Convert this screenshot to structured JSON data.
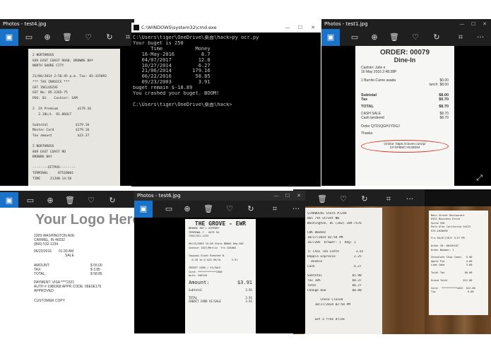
{
  "windows": {
    "test4": {
      "title": "Photos - test4.jpg",
      "receipt_lines": [
        "2 NORTHROSS",
        "849 EAST COAST ROAD, BROWNS BAY",
        "NORTH SHORE CITY",
        "",
        "21/06/2014 2:56:45 p.m. Tax: 03-325092",
        "*** TAX INVOICE ***",
        "GST INCLUSIVE",
        "GST No: 85-2265-75",
        "POS: 01    Cashier: SAM",
        "",
        "2  2X Premium          $179.16",
        "   2.18L/L  91.86ULT",
        "",
        "Subtotal              $179.16",
        "Master Card           $179.16",
        "Tax amount             $23.37",
        "",
        "2 NORTHROSS",
        "849 EAST COAST RD",
        "BROWNS BAY",
        "",
        "--------EFTPOS--------",
        "TERMINAL     8751B001",
        "TIME     21JUN 14:56"
      ]
    },
    "cmd": {
      "title": "C:\\WINDOWS\\system32\\cmd.exe",
      "lines": [
        "C:\\Users\\tiger\\OneDrive\\桌面\\hack>py ocr.py",
        "Your buget is 250",
        "      Time           Money",
        "   16-May-2016         8.7",
        "   04/07/2017         12.0",
        "   10/27/2014         6.27",
        "   21/06/2014       179.16",
        "   06/22/2016        58.85",
        "   09/23/2003         3.91",
        "buget remain $-18.89",
        "You crashed your buget. BOOM!",
        "",
        "C:\\Users\\tiger\\OneDrive\\桌面\\hack>"
      ]
    },
    "test1": {
      "title": "Photos - test1.jpg",
      "order": "ORDER: 00079",
      "type": "Dine-In",
      "cashier": "Cashier: Julie e",
      "datetime": "16 May 2016 2:48:38P",
      "item": "1  Burrito-Carne asada",
      "item_sub": "lunch",
      "item_price1": "$0.00",
      "item_price2": "$8.00",
      "subtotal_label": "Subtotal",
      "subtotal": "$8.00",
      "tax_label": "Tax",
      "tax": "$0.70",
      "total_label": "TOTAL",
      "total": "$8.70",
      "cash_sale_label": "CASH SALE",
      "cash_sale": "$8.70",
      "cash_tendered_label": "Cash tendered",
      "cash_tendered": "$8.70",
      "order_id": "Order Q7D1QGH1YDGJ",
      "thanks": "Thanks",
      "online": "Online: https://clover.com/p/",
      "online_code": "CFXP8MCYK2EEM"
    },
    "logo": {
      "logo_text": "Your Logo Here",
      "addr1": "2309 WASHINGTON AVE",
      "addr2": "CARMEL, IN 46032",
      "phone": "(866) 532-1234",
      "date": "06/22/2016",
      "time": "01:30 AM",
      "sale": "SALE",
      "amount_label": "AMOUNT:",
      "amount": "$ 55.00",
      "tax_label": "TAX:",
      "tax": "$  3.85",
      "total_label": "TOTAL:",
      "total": "$ 58.85",
      "payment": "PAYMENT: VISA ****2321",
      "auth": "AUTH # 1986368  APPR CODE: 06E0E176",
      "approved": "APPROVED",
      "customer_copy": "CUSTOMER COPY"
    },
    "test6": {
      "title": "Photos - test6.jpg",
      "receipt_title": "THE GROVE - EWR",
      "receipt_lines": [
        "NEWARK INT'L AIRPORT",
        "TERMINAL C - GATE 94",
        "7302/531-1234",
        "",
        "09/23/2003 15:38 Store B0062 Reg 001",
        "Cashier 1027/Merlin  Trn C04004",
        "",
        "Cappuwi Giant Roasted N.",
        "  0.28 lb @ $13.99/lb       3.91",
        "",
        "CREDIT CARD / VI/SALE",
        "Card: ************3300",
        "Auth: 540120"
      ],
      "amount_label": "Amount:",
      "amount": "$3.91",
      "subtotal_label": "Subtotal",
      "subtotal": "3.91",
      "total_label": "TOTAL",
      "total": "3.91",
      "total_sub": "CREDIT CARD  VI/SALE",
      "total_sub2": "3.91"
    },
    "starbucks": {
      "receipt_lines": [
        "STARBUCKS Store #7249",
        "865 7th Street NW",
        "Washington, DC (202) 289-7576",
        "",
        "CHK 003692",
        "10/27/2014 02:58 PM",
        "1677205  Drawer: 1  Reg: 2",
        "",
        "Tl Chai Tea Latte         3.65",
        "Dopplo Espresso          2.25",
        "  Double",
        "Cash                     6.27",
        "",
        "Subtotal                $5.90",
        "Tax 10%                 $0.37",
        "Total                   $6.27",
        "Change Due              $0.00",
        "",
        "       Check Closed",
        "    10/27/2014 02:58 PM",
        "",
        "",
        "    Get a free drink"
      ]
    },
    "mainst": {
      "receipt_lines": [
        "Main Street Restaurant",
        "6332 Business Drive",
        "Suite 528",
        "Palo Alto California 94123",
        "575-1628095",
        "",
        "Fri 04/07/2017 3:57 PM",
        "",
        "Order ID: #0439107",
        "Order Number: 1",
        "",
        "Chocolate Chip Cooki   5.00",
        "Apple Pie              4.00",
        "Lime Cake              3.00",
        "",
        "Total Tax             $0.00",
        "",
        "Grand Total          $12.00",
        "",
        "Card:  **********4422  $12.00",
        "Tip                     0.00"
      ]
    }
  },
  "icons": {
    "tools": [
      "image-icon",
      "slideshow-icon",
      "zoom-icon",
      "delete-icon",
      "heart-icon",
      "rotate-icon",
      "crop-icon",
      "more-icon"
    ]
  },
  "glyphs": {
    "minimize": "—",
    "maximize": "☐",
    "close": "✕",
    "zoom": "⊕",
    "delete": "🗑",
    "heart": "♡",
    "rotate": "↻",
    "crop": "⌗",
    "more": "···",
    "expand": "⤢",
    "slideshow": "▭",
    "image": "▣"
  }
}
